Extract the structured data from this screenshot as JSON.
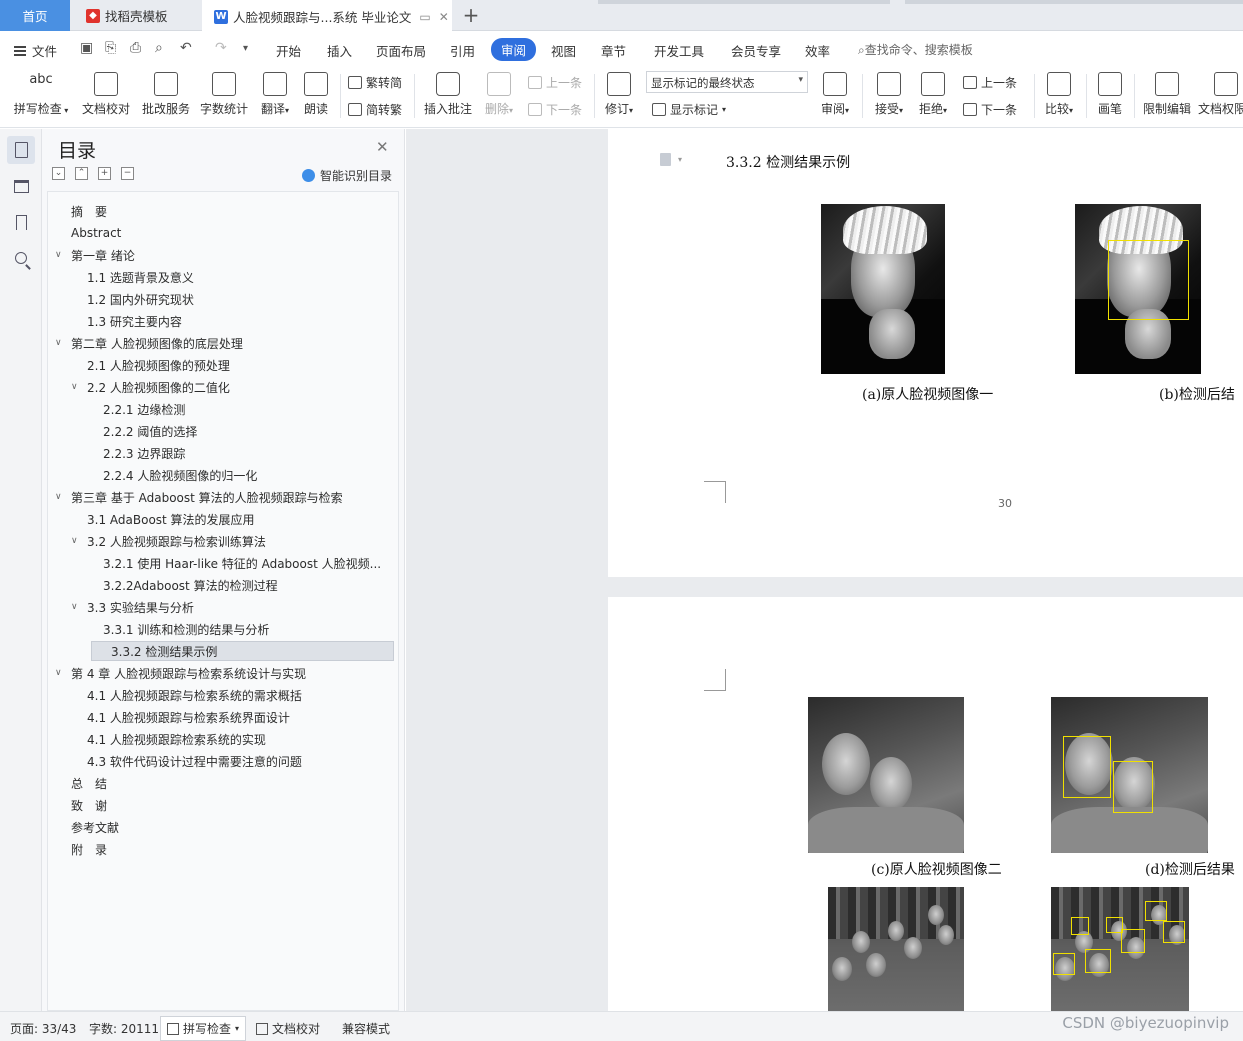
{
  "tabs": {
    "home": "首页",
    "template": "找稻壳模板",
    "document": "人脸视频跟踪与...系统 毕业论文"
  },
  "menu": {
    "file": "文件",
    "items": [
      "开始",
      "插入",
      "页面布局",
      "引用",
      "审阅",
      "视图",
      "章节",
      "开发工具",
      "会员专享",
      "效率"
    ],
    "active": "审阅",
    "search": "查找命令、搜索模板"
  },
  "ribbon": {
    "spellcheck": "拼写检查",
    "proofread": "文档校对",
    "batch": "批改服务",
    "wordcount": "字数统计",
    "translate": "翻译",
    "read_aloud": "朗读",
    "to_traditional": "繁转简",
    "to_simplified": "简转繁",
    "insert_comment": "插入批注",
    "delete": "删除",
    "prev_comment": "上一条",
    "next_comment": "下一条",
    "revise": "修订",
    "markup_state": "显示标记的最终状态",
    "show_markup": "显示标记",
    "review": "审阅",
    "accept": "接受",
    "reject": "拒绝",
    "prev": "上一条",
    "next": "下一条",
    "compare": "比较",
    "pen": "画笔",
    "restrict": "限制编辑",
    "doc_perm": "文档权限",
    "icon_abc": "abc"
  },
  "toc": {
    "title": "目录",
    "smart": "智能识别目录",
    "items": [
      {
        "label": "摘　要",
        "level": 1,
        "chev": ""
      },
      {
        "label": "Abstract",
        "level": 1,
        "chev": ""
      },
      {
        "label": "第一章  绪论",
        "level": 1,
        "chev": "v"
      },
      {
        "label": "1.1 选题背景及意义",
        "level": 2,
        "chev": ""
      },
      {
        "label": "1.2 国内外研究现状",
        "level": 2,
        "chev": ""
      },
      {
        "label": "1.3 研究主要内容",
        "level": 2,
        "chev": ""
      },
      {
        "label": "第二章  人脸视频图像的底层处理",
        "level": 1,
        "chev": "v"
      },
      {
        "label": "2.1 人脸视频图像的预处理",
        "level": 2,
        "chev": ""
      },
      {
        "label": "2.2 人脸视频图像的二值化",
        "level": 2,
        "chev": "v"
      },
      {
        "label": "2.2.1 边缘检测",
        "level": 3,
        "chev": ""
      },
      {
        "label": "2.2.2 阈值的选择",
        "level": 3,
        "chev": ""
      },
      {
        "label": "2.2.3 边界跟踪",
        "level": 3,
        "chev": ""
      },
      {
        "label": "2.2.4 人脸视频图像的归一化",
        "level": 3,
        "chev": ""
      },
      {
        "label": "第三章  基于 Adaboost 算法的人脸视频跟踪与检索",
        "level": 1,
        "chev": "v"
      },
      {
        "label": "3.1 AdaBoost 算法的发展应用",
        "level": 2,
        "chev": ""
      },
      {
        "label": "3.2  人脸视频跟踪与检索训练算法",
        "level": 2,
        "chev": "v"
      },
      {
        "label": "3.2.1 使用 Haar-like 特征的 Adaboost 人脸视频...",
        "level": 3,
        "chev": ""
      },
      {
        "label": "3.2.2Adaboost 算法的检测过程",
        "level": 3,
        "chev": ""
      },
      {
        "label": "3.3 实验结果与分析",
        "level": 2,
        "chev": "v"
      },
      {
        "label": "3.3.1 训练和检测的结果与分析",
        "level": 3,
        "chev": ""
      },
      {
        "label": "3.3.2 检测结果示例",
        "level": 3,
        "chev": "",
        "selected": true
      },
      {
        "label": "第 4 章  人脸视频跟踪与检索系统设计与实现",
        "level": 1,
        "chev": "v"
      },
      {
        "label": "4.1 人脸视频跟踪与检索系统的需求概括",
        "level": 2,
        "chev": ""
      },
      {
        "label": "4.1 人脸视频跟踪与检索系统界面设计",
        "level": 2,
        "chev": ""
      },
      {
        "label": "4.1 人脸视频跟踪检索系统的实现",
        "level": 2,
        "chev": ""
      },
      {
        "label": "4.3 软件代码设计过程中需要注意的问题",
        "level": 2,
        "chev": ""
      },
      {
        "label": "总　结",
        "level": 1,
        "chev": ""
      },
      {
        "label": "致　谢",
        "level": 1,
        "chev": ""
      },
      {
        "label": "参考文献",
        "level": 1,
        "chev": ""
      },
      {
        "label": "附　录",
        "level": 1,
        "chev": ""
      }
    ]
  },
  "document": {
    "heading": "3.3.2 检测结果示例",
    "caption_a": "(a)原人脸视频图像一",
    "caption_b": "(b)检测后结",
    "page_number": "30",
    "caption_c": "(c)原人脸视频图像二",
    "caption_d": "(d)检测后结果"
  },
  "status": {
    "page": "页面: 33/43",
    "words": "字数: 20111",
    "spellcheck": "拼写检查",
    "proofread": "文档校对",
    "compat": "兼容模式"
  },
  "watermark": "CSDN @biyezuopinvip",
  "colors": {
    "accent": "#2f6fde",
    "home_tab": "#4a90e2",
    "detection_box": "#f0e000"
  }
}
